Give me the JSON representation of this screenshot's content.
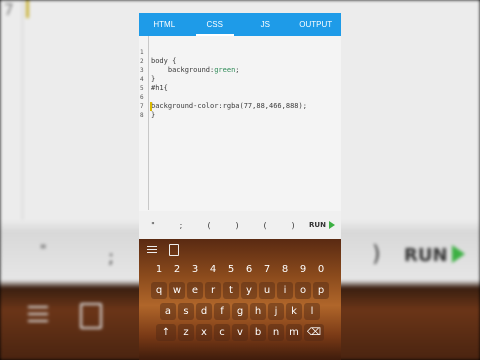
{
  "background": {
    "line_number": "7",
    "quote": "\"",
    "semicolon": ";",
    "paren": ")",
    "run_label": "RUN"
  },
  "tabs": [
    {
      "label": "HTML",
      "active": false
    },
    {
      "label": "CSS",
      "active": true
    },
    {
      "label": "JS",
      "active": false
    },
    {
      "label": "OUTPUT",
      "active": false
    }
  ],
  "editor": {
    "lines": [
      {
        "num": "1",
        "text": "body {"
      },
      {
        "num": "2",
        "text": "    background:green;"
      },
      {
        "num": "3",
        "text": "}"
      },
      {
        "num": "4",
        "text": "#h1{"
      },
      {
        "num": "5",
        "text": ""
      },
      {
        "num": "6",
        "text": "background-color:rgba(77,88,466,888);"
      },
      {
        "num": "7",
        "text": "}"
      },
      {
        "num": "8",
        "text": ""
      }
    ]
  },
  "symbols": [
    "\"",
    ";",
    "(",
    ")",
    "(",
    ")"
  ],
  "run_label": "RUN",
  "keyboard": {
    "numbers": [
      "1",
      "2",
      "3",
      "4",
      "5",
      "6",
      "7",
      "8",
      "9",
      "0"
    ],
    "row1": [
      "q",
      "w",
      "e",
      "r",
      "t",
      "y",
      "u",
      "i",
      "o",
      "p"
    ],
    "row2": [
      "a",
      "s",
      "d",
      "f",
      "g",
      "h",
      "j",
      "k",
      "l"
    ],
    "row3": [
      "↑",
      "z",
      "x",
      "c",
      "v",
      "b",
      "n",
      "m",
      "⌫"
    ]
  },
  "colors": {
    "tab_bar": "#1e9be8",
    "run_play": "#3cb043",
    "cursor": "#d9b800"
  }
}
